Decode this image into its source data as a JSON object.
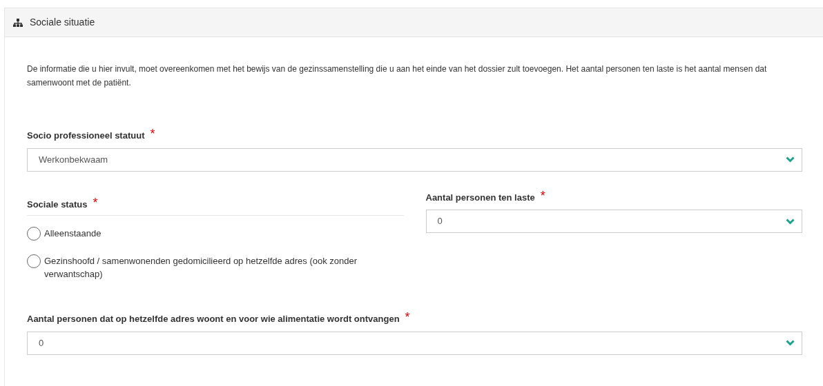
{
  "panel": {
    "title": "Sociale situatie"
  },
  "intro": "De informatie die u hier invult, moet overeenkomen met het bewijs van de gezinssamenstelling die u aan het einde van het dossier zult toevoegen. Het aantal personen ten laste is het aantal mensen dat samenwoont met de patiënt.",
  "status_field": {
    "label": "Socio professioneel statuut",
    "required_mark": "*",
    "value": "Werkonbekwaam"
  },
  "social_status": {
    "label": "Sociale status",
    "required_mark": "*",
    "options": [
      {
        "label": "Alleenstaande",
        "selected": false
      },
      {
        "label": "Gezinshoofd / samenwonenden gedomicilieerd op hetzelfde adres (ook zonder verwantschap)",
        "selected": false
      }
    ]
  },
  "dependents_field": {
    "label": "Aantal personen ten laste",
    "required_mark": "*",
    "value": "0"
  },
  "alimony_field": {
    "label": "Aantal personen dat op hetzelfde adres woont en voor wie alimentatie wordt ontvangen",
    "required_mark": "*",
    "value": "0"
  }
}
